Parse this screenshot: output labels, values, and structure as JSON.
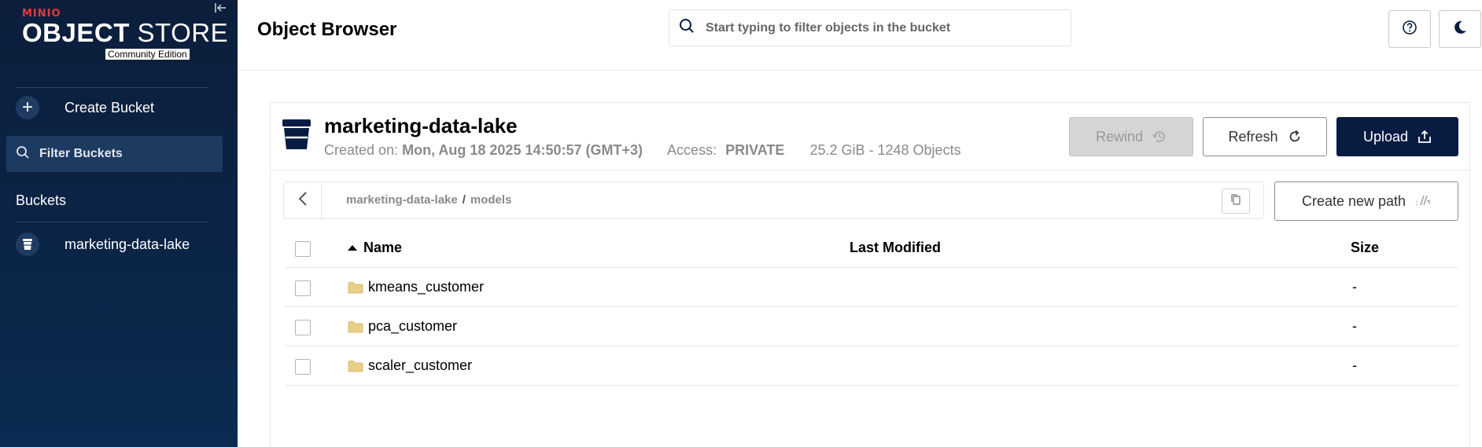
{
  "app": {
    "brand": "MINIO",
    "product_bold": "OBJECT",
    "product_light": " STORE",
    "edition": "Community Edition"
  },
  "sidebar": {
    "create_bucket": "Create Bucket",
    "filter_buckets": "Filter Buckets",
    "buckets_title": "Buckets",
    "buckets": [
      {
        "label": "marketing-data-lake"
      }
    ]
  },
  "header": {
    "title": "Object Browser",
    "search_placeholder": "Start typing to filter objects in the bucket"
  },
  "bucket": {
    "name": "marketing-data-lake",
    "created_label": "Created on:",
    "created_value": "Mon, Aug 18 2025 14:50:57 (GMT+3)",
    "access_label": "Access:",
    "access_value": "PRIVATE",
    "usage": "25.2 GiB - 1248 Objects"
  },
  "actions": {
    "rewind": "Rewind",
    "refresh": "Refresh",
    "upload": "Upload",
    "create_new_path": "Create new path"
  },
  "breadcrumb": {
    "segments": [
      "marketing-data-lake",
      "models"
    ],
    "separator": "/"
  },
  "table": {
    "headers": {
      "name": "Name",
      "last_modified": "Last Modified",
      "size": "Size"
    },
    "rows": [
      {
        "name": "kmeans_customer",
        "last_modified": "",
        "size": "-"
      },
      {
        "name": "pca_customer",
        "last_modified": "",
        "size": "-"
      },
      {
        "name": "scaler_customer",
        "last_modified": "",
        "size": "-"
      }
    ]
  },
  "colors": {
    "sidebar_bg": "#0c1e3c",
    "brand_red": "#e03a3e",
    "upload_bg": "#081c42",
    "folder": "#e8cf8a"
  }
}
